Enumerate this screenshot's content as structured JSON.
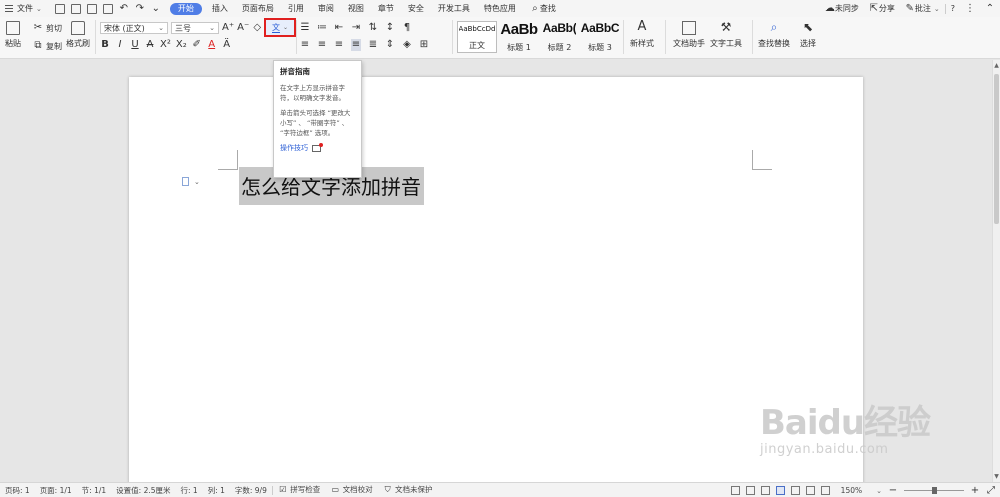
{
  "menubar": {
    "file": "文件",
    "tabs": [
      "开始",
      "插入",
      "页面布局",
      "引用",
      "审阅",
      "视图",
      "章节",
      "安全",
      "开发工具",
      "特色应用"
    ],
    "active_tab": "开始",
    "search": "查找",
    "right": {
      "sync": "未同步",
      "share": "分享",
      "comment": "批注",
      "help": "?"
    }
  },
  "ribbon": {
    "paste": "粘贴",
    "cut": "剪切",
    "copy": "复制",
    "format_painter": "格式刷",
    "font_name": "宋体 (正文)",
    "font_size": "三号",
    "bold": "B",
    "italic": "I",
    "underline": "U",
    "strike": "A",
    "superscript": "X²",
    "subscript": "X₂",
    "font_color": "A",
    "pinyin_label": "文",
    "styles": [
      {
        "sample": "AaBbCcDd",
        "name": "正文"
      },
      {
        "sample": "AaBb",
        "name": "标题 1"
      },
      {
        "sample": "AaBb(",
        "name": "标题 2"
      },
      {
        "sample": "AaBbC",
        "name": "标题 3"
      }
    ],
    "new_style": "新样式",
    "doc_assistant": "文档助手",
    "text_tool": "文字工具",
    "find_replace": "查找替换",
    "select": "选择"
  },
  "tooltip": {
    "title": "拼音指南",
    "line1": "在文字上方显示拼音字符，以明确文字发音。",
    "line2": "单击箭头可选择 “更改大小写” 、 “带圈字符” 、 “字符边框” 选项。",
    "link": "操作技巧"
  },
  "document": {
    "text": "怎么给文字添加拼音"
  },
  "watermark": {
    "logo": "Baidu经验",
    "url": "jingyan.baidu.com"
  },
  "statusbar": {
    "page_num": "页码: 1",
    "pages": "页面: 1/1",
    "section": "节: 1/1",
    "setting": "设置值: 2.5厘米",
    "row": "行: 1",
    "col": "列: 1",
    "words": "字数: 9/9",
    "spell": "拼写检查",
    "proof": "文档校对",
    "protect": "文档未保护",
    "zoom": "150%"
  },
  "colors": {
    "accent": "#4f7de6",
    "highlight_box": "#e02020",
    "selection": "#c8c8c8"
  }
}
